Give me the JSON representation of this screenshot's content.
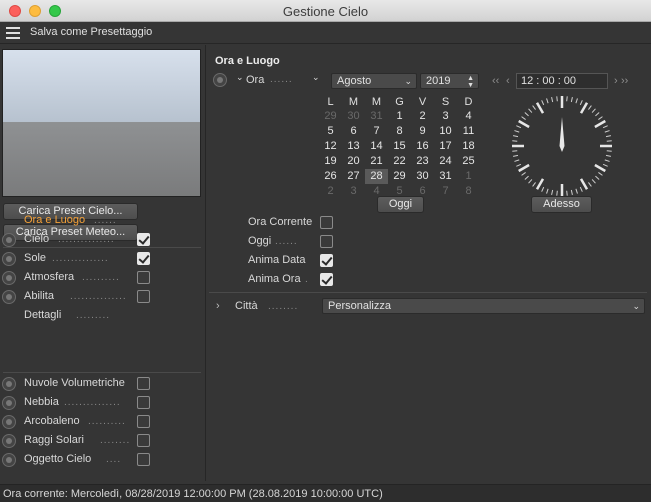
{
  "window": {
    "title": "Gestione Cielo"
  },
  "menubar": {
    "label": "Salva come Presettaggio"
  },
  "left": {
    "buttons": {
      "load_sky": "Carica Preset Cielo...",
      "load_weather": "Carica Preset Meteo..."
    },
    "group1": [
      {
        "label": "Ora e Luogo",
        "dots": "......",
        "active": true,
        "radio": false,
        "checkbox": false,
        "checked": false
      },
      {
        "label": "Cielo",
        "dots": "...............",
        "radio": true,
        "checkbox": true,
        "checked": true
      },
      {
        "label": "Sole",
        "dots": "...............",
        "radio": true,
        "checkbox": true,
        "checked": true
      },
      {
        "label": "Atmosfera",
        "dots": "..........",
        "radio": true,
        "checkbox": true,
        "checked": false
      },
      {
        "label": "Abilita",
        "dots": "...............",
        "radio": true,
        "checkbox": true,
        "checked": false
      },
      {
        "label": "Dettagli",
        "dots": ".........",
        "radio": false,
        "checkbox": false,
        "checked": false
      }
    ],
    "group2": [
      {
        "label": "Nuvole Volumetriche",
        "dots": "",
        "checked": false
      },
      {
        "label": "Nebbia",
        "dots": "...............",
        "checked": false
      },
      {
        "label": "Arcobaleno",
        "dots": "..........",
        "checked": false
      },
      {
        "label": "Raggi Solari",
        "dots": "........",
        "checked": false
      },
      {
        "label": "Oggetto Cielo",
        "dots": "....",
        "checked": false
      }
    ]
  },
  "right": {
    "section_title": "Ora e Luogo",
    "ora_label": "Ora",
    "ora_dots": "......",
    "month": "Agosto",
    "year": "2019",
    "time": "12 : 00 : 00",
    "calendar": {
      "weekdays": [
        "L",
        "M",
        "M",
        "G",
        "V",
        "S",
        "D"
      ],
      "weeks": [
        [
          {
            "d": "29",
            "dim": true
          },
          {
            "d": "30",
            "dim": true
          },
          {
            "d": "31",
            "dim": true
          },
          {
            "d": "1"
          },
          {
            "d": "2"
          },
          {
            "d": "3"
          },
          {
            "d": "4"
          }
        ],
        [
          {
            "d": "5"
          },
          {
            "d": "6"
          },
          {
            "d": "7"
          },
          {
            "d": "8"
          },
          {
            "d": "9"
          },
          {
            "d": "10"
          },
          {
            "d": "11"
          }
        ],
        [
          {
            "d": "12"
          },
          {
            "d": "13"
          },
          {
            "d": "14"
          },
          {
            "d": "15"
          },
          {
            "d": "16"
          },
          {
            "d": "17"
          },
          {
            "d": "18"
          }
        ],
        [
          {
            "d": "19"
          },
          {
            "d": "20"
          },
          {
            "d": "21"
          },
          {
            "d": "22"
          },
          {
            "d": "23"
          },
          {
            "d": "24"
          },
          {
            "d": "25"
          }
        ],
        [
          {
            "d": "26"
          },
          {
            "d": "27"
          },
          {
            "d": "28",
            "sel": true
          },
          {
            "d": "29"
          },
          {
            "d": "30"
          },
          {
            "d": "31"
          },
          {
            "d": "1",
            "dim": true
          }
        ],
        [
          {
            "d": "2",
            "dim": true
          },
          {
            "d": "3",
            "dim": true
          },
          {
            "d": "4",
            "dim": true
          },
          {
            "d": "5",
            "dim": true
          },
          {
            "d": "6",
            "dim": true
          },
          {
            "d": "7",
            "dim": true
          },
          {
            "d": "8",
            "dim": true
          }
        ]
      ]
    },
    "today_button": "Oggi",
    "now_button": "Adesso",
    "options": [
      {
        "label": "Ora Corrente",
        "dots": "",
        "checked": false
      },
      {
        "label": "Oggi",
        "dots": "......",
        "checked": false
      },
      {
        "label": "Anima Data",
        "dots": "",
        "checked": true
      },
      {
        "label": "Anima Ora",
        "dots": ".",
        "checked": true
      }
    ],
    "city": {
      "label": "Città",
      "dots": "........",
      "value": "Personalizza"
    }
  },
  "status": {
    "text": "Ora corrente:  Mercoledì, 08/28/2019 12:00:00 PM  (28.08.2019  10:00:00 UTC)"
  }
}
